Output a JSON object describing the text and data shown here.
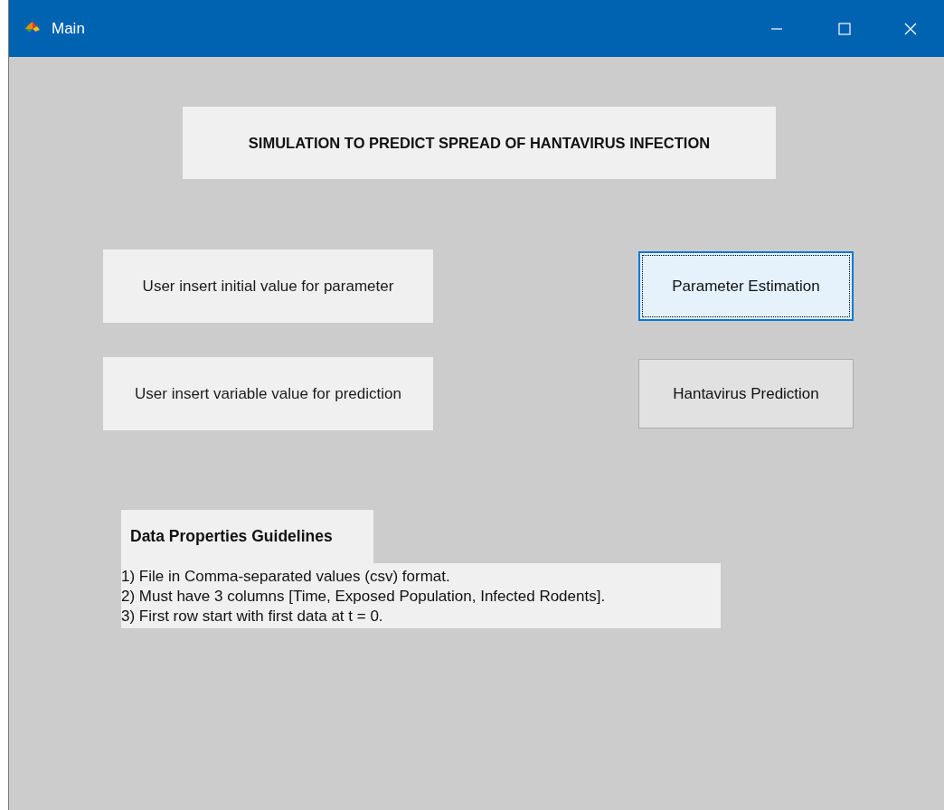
{
  "window": {
    "title": "Main"
  },
  "heading": "SIMULATION TO PREDICT SPREAD OF HANTAVIRUS INFECTION",
  "rows": [
    {
      "label": "User insert initial value for parameter",
      "button": {
        "label": "Parameter Estimation",
        "focused": true
      }
    },
    {
      "label": "User insert variable value for prediction",
      "button": {
        "label": "Hantavirus Prediction",
        "focused": false
      }
    }
  ],
  "guidelines": {
    "title": "Data Properties Guidelines",
    "lines": [
      "1) File in Comma-separated values (csv) format.",
      "2) Must have 3 columns [Time, Exposed Population, Infected Rodents].",
      "3) First row start with first data at t = 0."
    ]
  }
}
